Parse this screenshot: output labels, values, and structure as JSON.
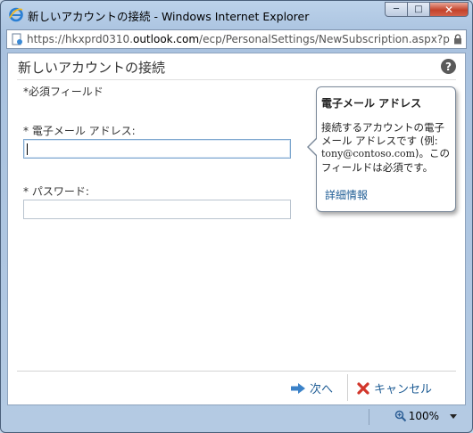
{
  "window": {
    "title": "新しいアカウントの接続 - Windows Internet Explorer",
    "controls": {
      "minimize": "─",
      "maximize": "□",
      "close": "✕"
    }
  },
  "addressbar": {
    "prefix": "https://hkxprd0310.",
    "domain": "outlook.com",
    "suffix": "/ecp/PersonalSettings/NewSubscription.aspx?pwmcid"
  },
  "page": {
    "title": "新しいアカウントの接続",
    "help_icon": "?",
    "required_note": "*必須フィールド"
  },
  "form": {
    "email_label": "* 電子メール アドレス:",
    "email_value": "",
    "password_label": "* パスワード:",
    "password_value": ""
  },
  "callout": {
    "title": "電子メール アドレス",
    "body_before": "接続するアカウントの電子メール アドレスです (例: ",
    "body_email": "tony@contoso.com",
    "body_after": ")。このフィールドは必須です。",
    "link": "詳細情報"
  },
  "footer": {
    "next_label": "次へ",
    "cancel_label": "キャンセル"
  },
  "statusbar": {
    "zoom": "100%"
  },
  "colors": {
    "link": "#1f5d95",
    "frame": "#bcd2ea",
    "close": "#c4432b"
  }
}
